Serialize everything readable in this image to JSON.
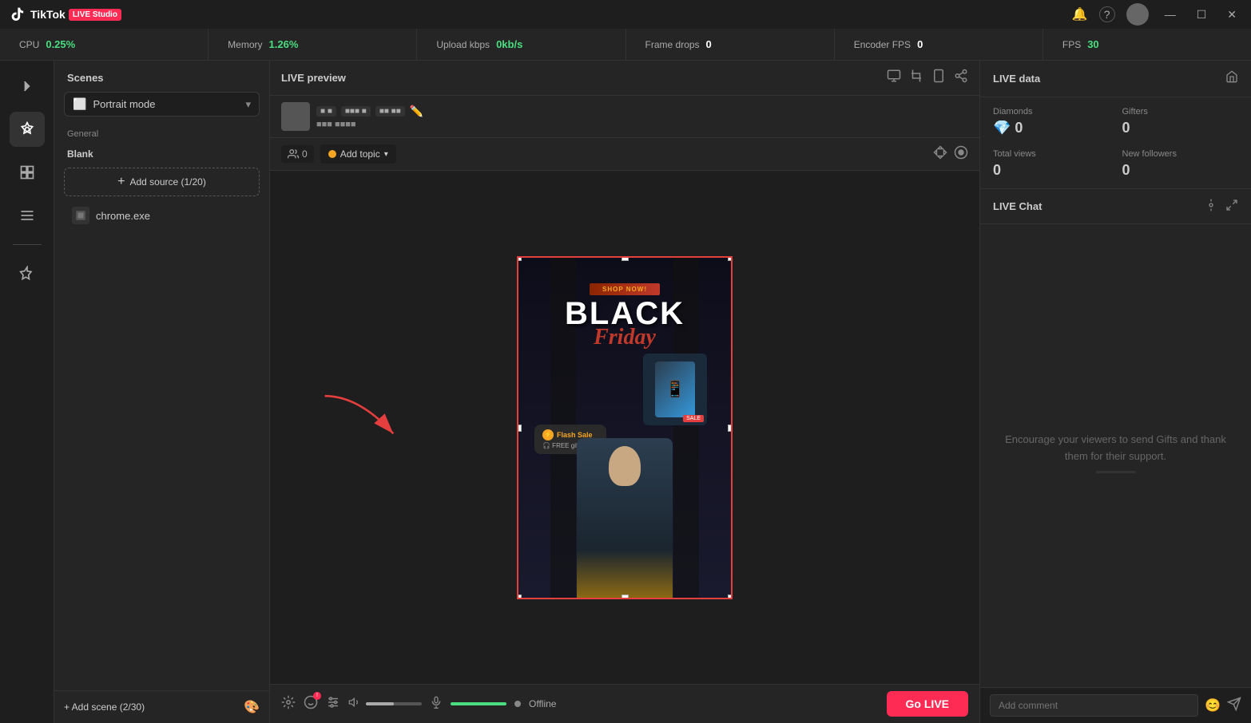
{
  "titlebar": {
    "app_name": "TikTok",
    "live_badge": "LIVE Studio",
    "notification_icon": "🔔",
    "help_icon": "?",
    "minimize_label": "—",
    "maximize_label": "☐",
    "close_label": "✕"
  },
  "statsbar": {
    "items": [
      {
        "label": "CPU",
        "value": "0.25%"
      },
      {
        "label": "Memory",
        "value": "1.26%"
      },
      {
        "label": "Upload kbps",
        "value": "0kb/s"
      },
      {
        "label": "Frame drops",
        "value": "0"
      },
      {
        "label": "Encoder FPS",
        "value": "0"
      },
      {
        "label": "FPS",
        "value": "30"
      }
    ]
  },
  "scenes": {
    "title": "Scenes",
    "mode": "Portrait mode",
    "general_label": "General",
    "blank_label": "Blank",
    "add_source_label": "Add source (1/20)",
    "sources": [
      {
        "name": "chrome.exe",
        "icon": "⬜"
      }
    ],
    "add_scene_label": "+ Add scene (2/30)"
  },
  "preview": {
    "title": "LIVE preview",
    "viewers_count": "0",
    "add_topic_label": "Add topic",
    "offline_label": "Offline",
    "go_live_label": "Go LIVE",
    "comment_placeholder": "Add comment"
  },
  "live_data": {
    "title": "LIVE data",
    "diamonds_label": "Diamonds",
    "diamonds_value": "0",
    "gifters_label": "Gifters",
    "gifters_value": "0",
    "total_views_label": "Total views",
    "total_views_value": "0",
    "new_followers_label": "New followers",
    "new_followers_value": "0"
  },
  "live_chat": {
    "title": "LIVE Chat",
    "placeholder": "Encourage your viewers to send Gifts and thank them for their support."
  }
}
